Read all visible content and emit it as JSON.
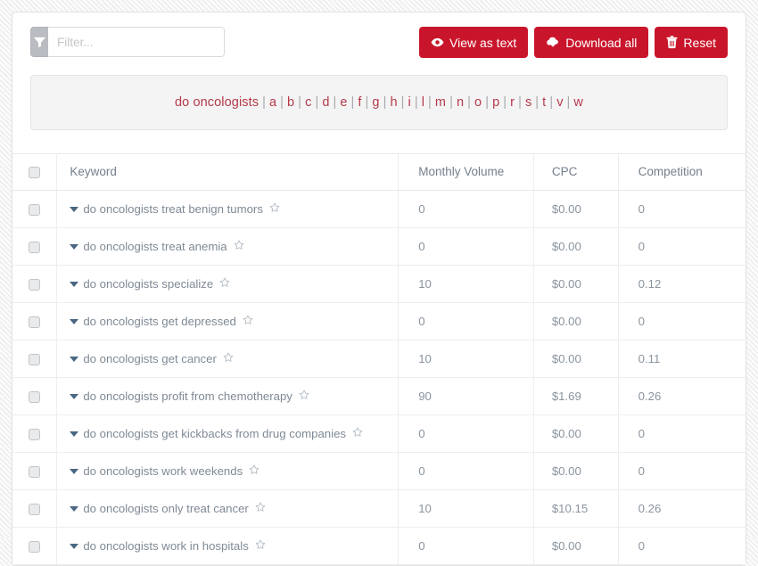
{
  "toolbar": {
    "filter_placeholder": "Filter...",
    "filter_value": "",
    "filter_icon": "funnel-icon",
    "buttons": [
      {
        "label": "View as text",
        "icon": "eye-icon",
        "name": "view-as-text-button"
      },
      {
        "label": "Download all",
        "icon": "cloud-download-icon",
        "name": "download-all-button"
      },
      {
        "label": "Reset",
        "icon": "trash-icon",
        "name": "reset-button"
      }
    ],
    "button_color": "#c9152b"
  },
  "alphabet_bar": {
    "root_term": "do oncologists",
    "separator": "|",
    "letters": [
      "a",
      "b",
      "c",
      "d",
      "e",
      "f",
      "g",
      "h",
      "i",
      "l",
      "m",
      "n",
      "o",
      "p",
      "r",
      "s",
      "t",
      "v",
      "w"
    ],
    "link_color": "#b5394a"
  },
  "table": {
    "headers": {
      "select_all": "",
      "keyword": "Keyword",
      "monthly_volume": "Monthly Volume",
      "cpc": "CPC",
      "competition": "Competition"
    },
    "rows": [
      {
        "keyword": "do oncologists treat benign tumors",
        "monthly_volume": "0",
        "cpc": "$0.00",
        "competition": "0"
      },
      {
        "keyword": "do oncologists treat anemia",
        "monthly_volume": "0",
        "cpc": "$0.00",
        "competition": "0"
      },
      {
        "keyword": "do oncologists specialize",
        "monthly_volume": "10",
        "cpc": "$0.00",
        "competition": "0.12"
      },
      {
        "keyword": "do oncologists get depressed",
        "monthly_volume": "0",
        "cpc": "$0.00",
        "competition": "0"
      },
      {
        "keyword": "do oncologists get cancer",
        "monthly_volume": "10",
        "cpc": "$0.00",
        "competition": "0.11"
      },
      {
        "keyword": "do oncologists profit from chemotherapy",
        "monthly_volume": "90",
        "cpc": "$1.69",
        "competition": "0.26"
      },
      {
        "keyword": "do oncologists get kickbacks from drug companies",
        "monthly_volume": "0",
        "cpc": "$0.00",
        "competition": "0"
      },
      {
        "keyword": "do oncologists work weekends",
        "monthly_volume": "0",
        "cpc": "$0.00",
        "competition": "0"
      },
      {
        "keyword": "do oncologists only treat cancer",
        "monthly_volume": "10",
        "cpc": "$10.15",
        "competition": "0.26"
      },
      {
        "keyword": "do oncologists work in hospitals",
        "monthly_volume": "0",
        "cpc": "$0.00",
        "competition": "0"
      }
    ]
  }
}
